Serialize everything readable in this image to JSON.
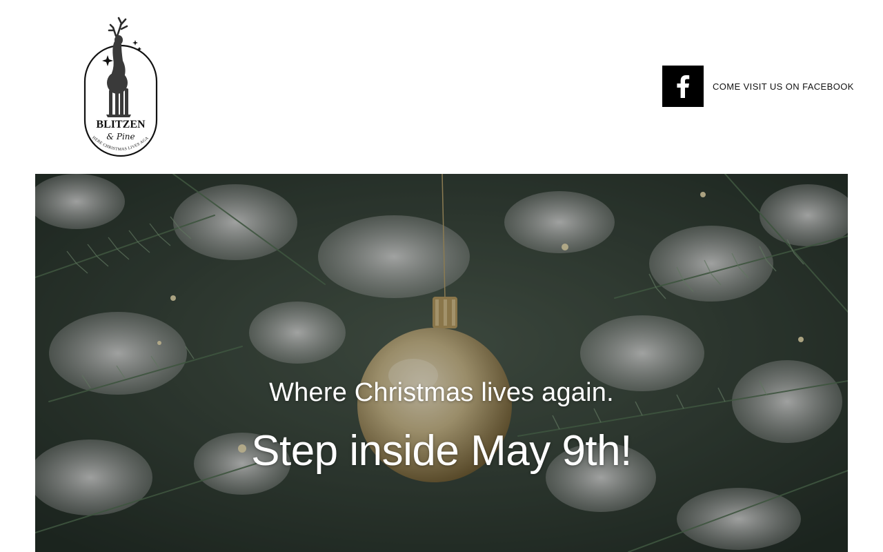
{
  "brand": {
    "name": "BLITZEN",
    "script_line": "& Pine",
    "motto_arc": "WHERE CHRISTMAS LIVES AGAIN"
  },
  "social": {
    "facebook_label": "COME VISIT US ON FACEBOOK",
    "icon": "facebook-icon"
  },
  "hero": {
    "tagline": "Where Christmas lives again.",
    "headline": "Step inside May 9th!",
    "image": "christmas-tree-gold-ornament"
  },
  "colors": {
    "facebook_box": "#000000",
    "hero_text": "#ffffff",
    "page_background": "#ffffff"
  }
}
